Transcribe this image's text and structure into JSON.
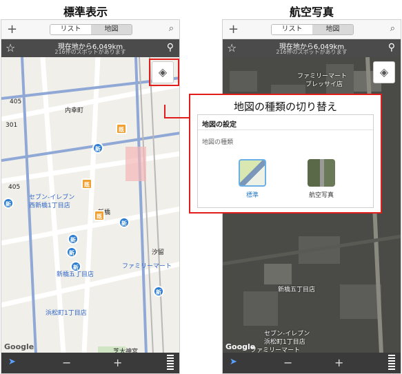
{
  "captions": {
    "left": "標準表示",
    "right": "航空写真"
  },
  "phones": {
    "standard": {
      "tabs": [
        "リスト",
        "地図"
      ],
      "distance": "現在地から6,049km",
      "spots": "216件のスポットがあります",
      "labels": [
        "内幸町",
        "新橋",
        "汐留",
        "セブン-イレブン",
        "西新橋1丁目店",
        "新橋五丁目店",
        "ファミリーマート",
        "浜松町1丁目店",
        "芝大神宮",
        "405",
        "301",
        "405"
      ],
      "google": "Google",
      "pins": [
        "新",
        "新",
        "新",
        "新",
        "新",
        "新",
        "新"
      ],
      "orange_pins": [
        "既",
        "既",
        "既"
      ]
    },
    "aerial": {
      "tabs": [
        "リスト",
        "地図"
      ],
      "distance": "現在地から6,049km",
      "spots": "216件のスポットがあります",
      "labels": [
        "ファミリーマート",
        "ブレッサイ店",
        "新橋五丁目店",
        "セブン-イレブン",
        "浜松町1丁目店",
        "ファミリーマート"
      ],
      "google": "Google"
    }
  },
  "callout": {
    "title": "地図の種類の切り替え",
    "panel_header": "地図の設定",
    "panel_sub": "地図の種類",
    "options": [
      "標準",
      "航空写真"
    ]
  },
  "colors": {
    "accent_red": "#e21b1b",
    "pin_blue": "#2d7dd2",
    "pin_orange": "#f0a030"
  }
}
